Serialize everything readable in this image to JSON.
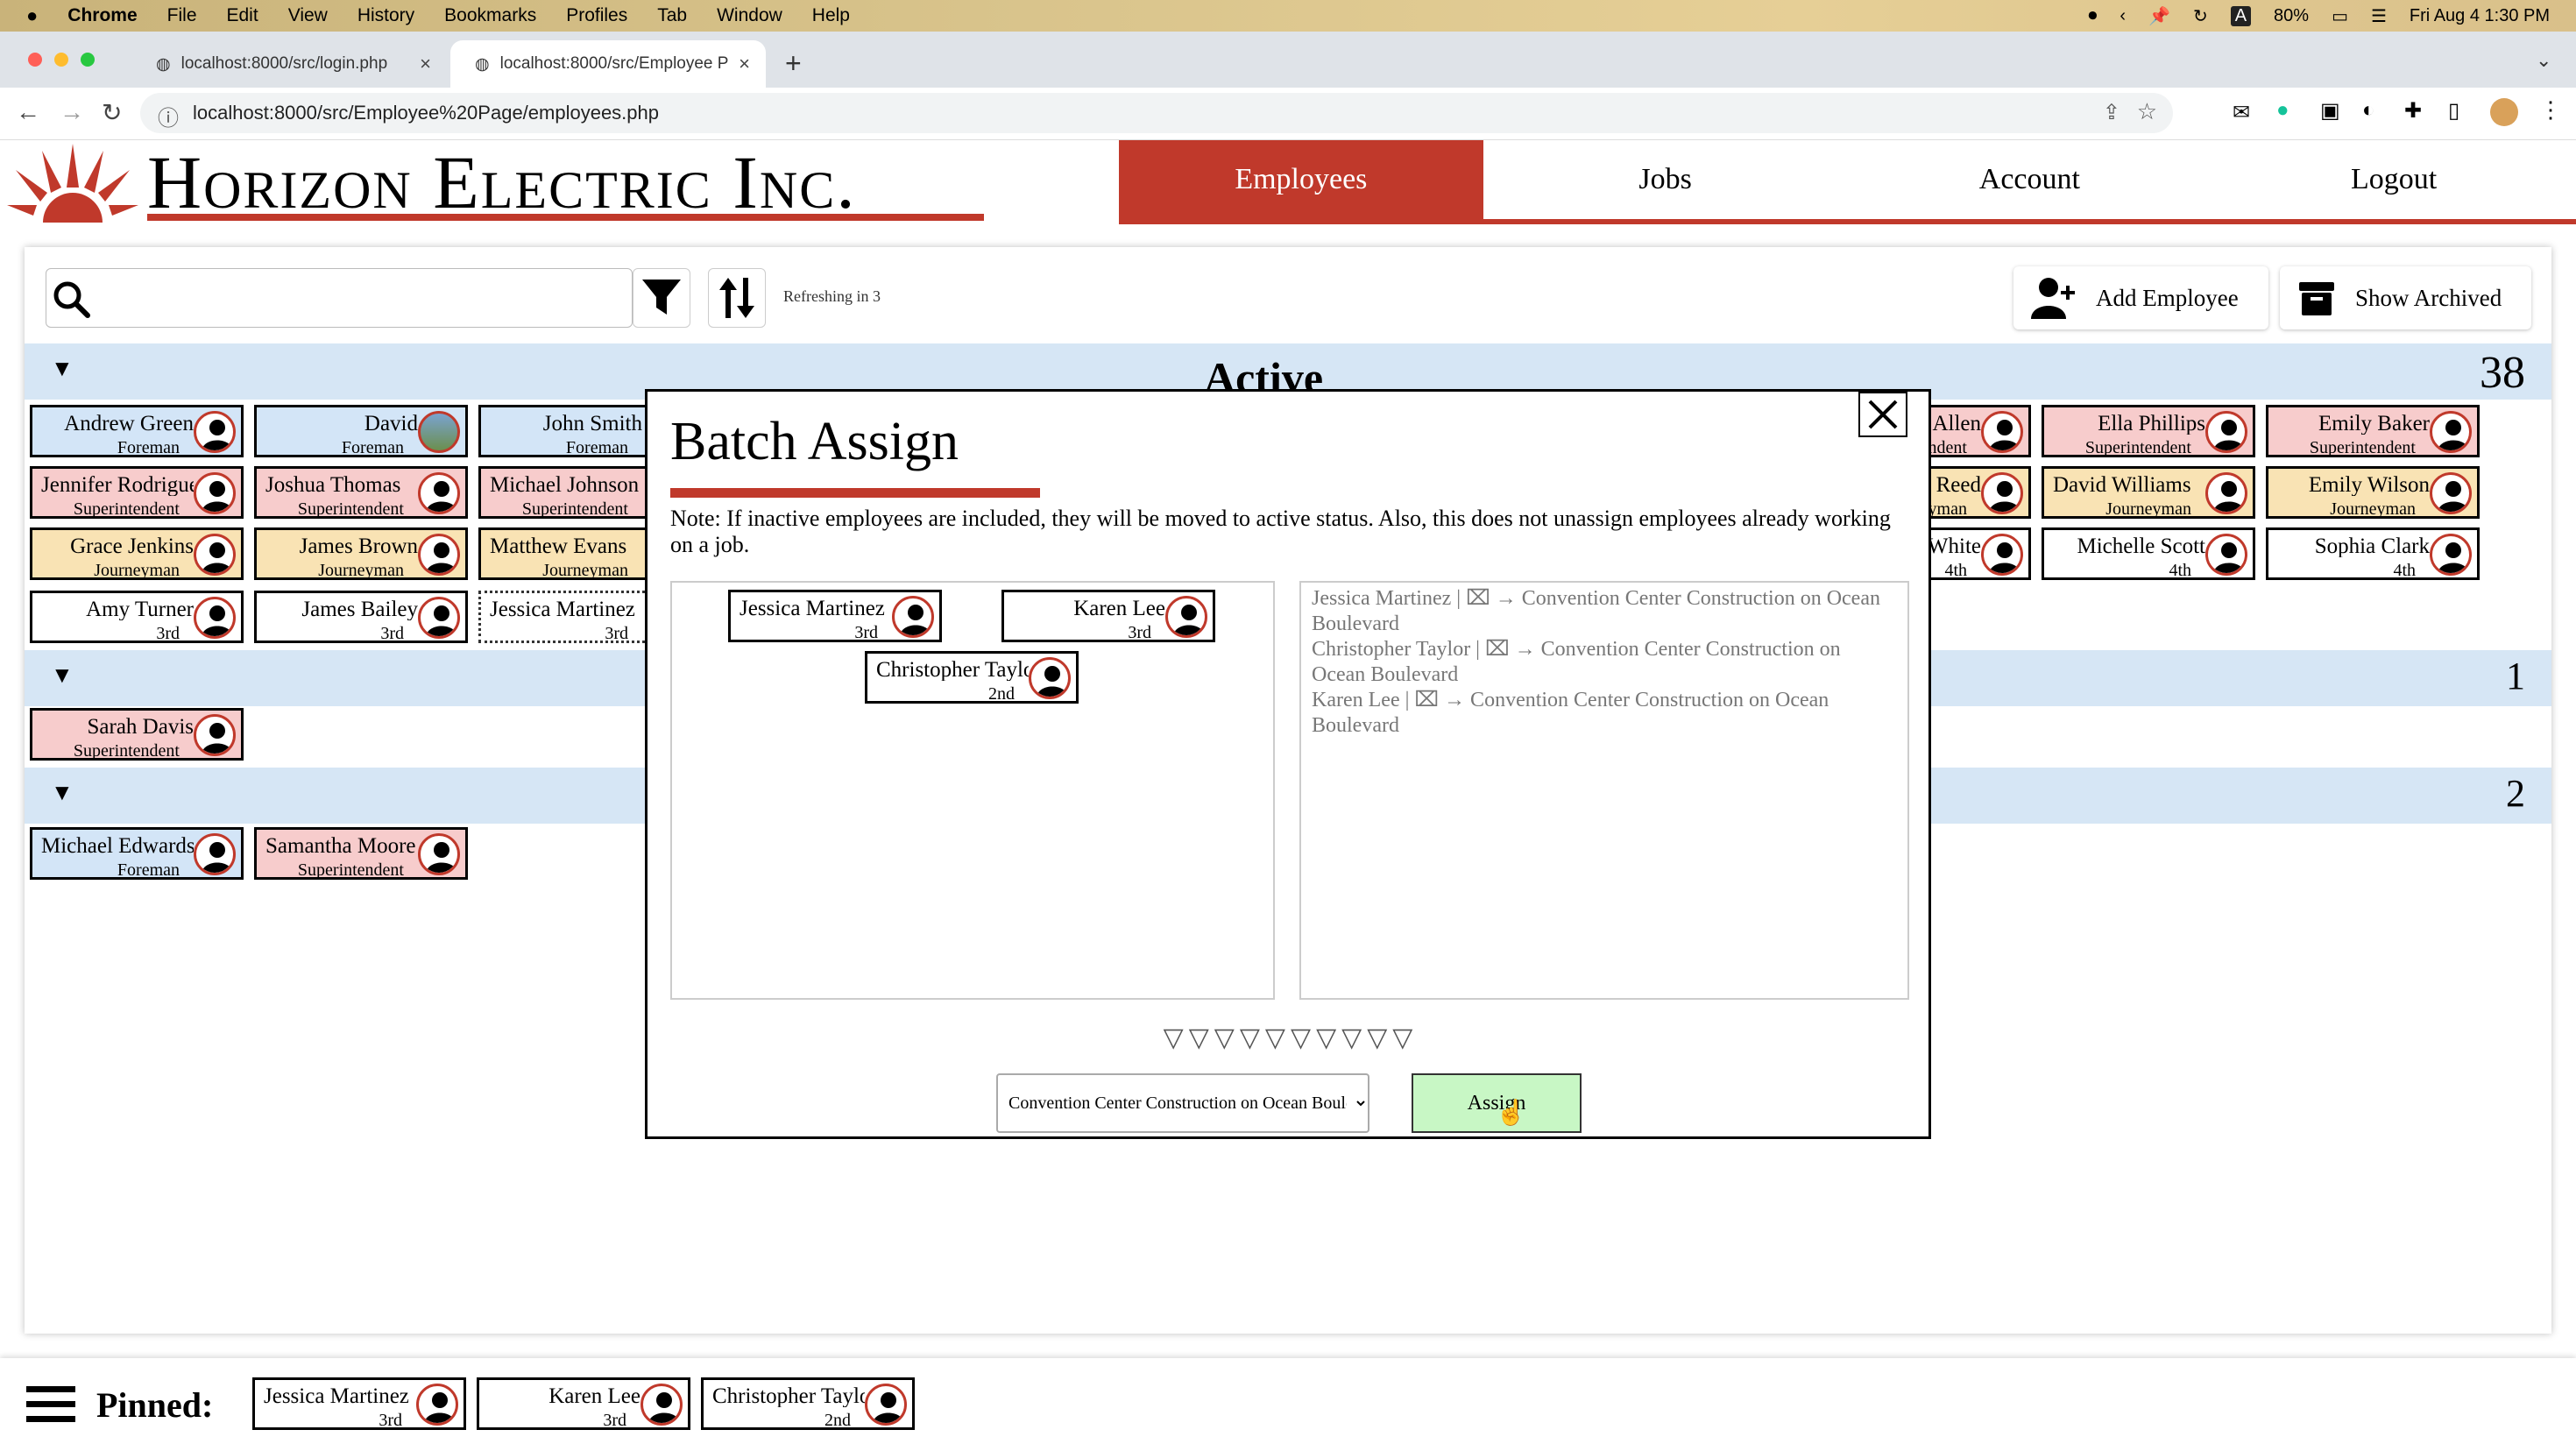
{
  "os_menubar": {
    "app": "Chrome",
    "items": [
      "File",
      "Edit",
      "View",
      "History",
      "Bookmarks",
      "Profiles",
      "Tab",
      "Window",
      "Help"
    ],
    "battery": "80%",
    "clock": "Fri Aug 4  1:30 PM"
  },
  "browser": {
    "tabs": [
      {
        "title": "localhost:8000/src/login.php"
      },
      {
        "title": "localhost:8000/src/Employee P"
      }
    ],
    "url": "localhost:8000/src/Employee%20Page/employees.php"
  },
  "site": {
    "logo_text": "Horizon Electric Inc.",
    "nav": [
      "Employees",
      "Jobs",
      "Account",
      "Logout"
    ],
    "accent_color": "#c0392b"
  },
  "toolbar": {
    "search_placeholder": "",
    "refresh_text": "Refreshing in 3",
    "add_employee": "Add Employee",
    "show_archived": "Show Archived"
  },
  "sections": [
    {
      "title": "Active",
      "count": "38"
    },
    {
      "title": "",
      "count": "1"
    },
    {
      "title": "",
      "count": "2"
    }
  ],
  "active_employees": [
    {
      "name": "Andrew Green",
      "role": "Foreman"
    },
    {
      "name": "David",
      "role": "Foreman"
    },
    {
      "name": "John Smith",
      "role": "Foreman"
    },
    {
      "name": "Jennifer Rodriguez",
      "role": "Superintendent"
    },
    {
      "name": "Joshua Thomas",
      "role": "Superintendent"
    },
    {
      "name": "Michael Johnson",
      "role": "Superintendent"
    },
    {
      "name": "Grace Jenkins",
      "role": "Journeyman"
    },
    {
      "name": "James Brown",
      "role": "Journeyman"
    },
    {
      "name": "Matthew Evans",
      "role": "Journeyman"
    },
    {
      "name": "Amy Turner",
      "role": "3rd"
    },
    {
      "name": "James Bailey",
      "role": "3rd"
    },
    {
      "name": "Jessica Martinez",
      "role": "3rd"
    },
    {
      "name": "Allen",
      "role": "Superintendent"
    },
    {
      "name": "Ella Phillips",
      "role": "Superintendent"
    },
    {
      "name": "Emily Baker",
      "role": "Superintendent"
    },
    {
      "name": "Reed",
      "role": "Journeyman"
    },
    {
      "name": "David Williams",
      "role": "Journeyman"
    },
    {
      "name": "Emily Wilson",
      "role": "Journeyman"
    },
    {
      "name": "White",
      "role": "4th"
    },
    {
      "name": "Michelle Scott",
      "role": "4th"
    },
    {
      "name": "Sophia Clark",
      "role": "4th"
    }
  ],
  "section2_employees": [
    {
      "name": "Sarah Davis",
      "role": "Superintendent"
    }
  ],
  "section3_employees": [
    {
      "name": "Michael Edwards",
      "role": "Foreman"
    },
    {
      "name": "Samantha Moore",
      "role": "Superintendent"
    }
  ],
  "modal": {
    "title": "Batch Assign",
    "note": "Note: If inactive employees are included, they will be moved to active status. Also, this does not unassign employees already working on a job.",
    "selected": [
      {
        "name": "Jessica Martinez",
        "role": "3rd"
      },
      {
        "name": "Karen Lee",
        "role": "3rd"
      },
      {
        "name": "Christopher Taylor",
        "role": "2nd"
      }
    ],
    "log": [
      "Jessica Martinez | ⌧ → Convention Center Construction on Ocean Boulevard",
      "Christopher Taylor | ⌧ → Convention Center Construction on Ocean Boulevard",
      "Karen Lee | ⌧ → Convention Center Construction on Ocean Boulevard"
    ],
    "dots": "▽▽▽▽▽▽▽▽▽▽",
    "job_selected": "Convention Center Construction on Ocean Boulevard",
    "assign_label": "Assign"
  },
  "pinned": {
    "label": "Pinned:",
    "employees": [
      {
        "name": "Jessica Martinez",
        "role": "3rd"
      },
      {
        "name": "Karen Lee",
        "role": "3rd"
      },
      {
        "name": "Christopher Taylor",
        "role": "2nd"
      }
    ]
  }
}
